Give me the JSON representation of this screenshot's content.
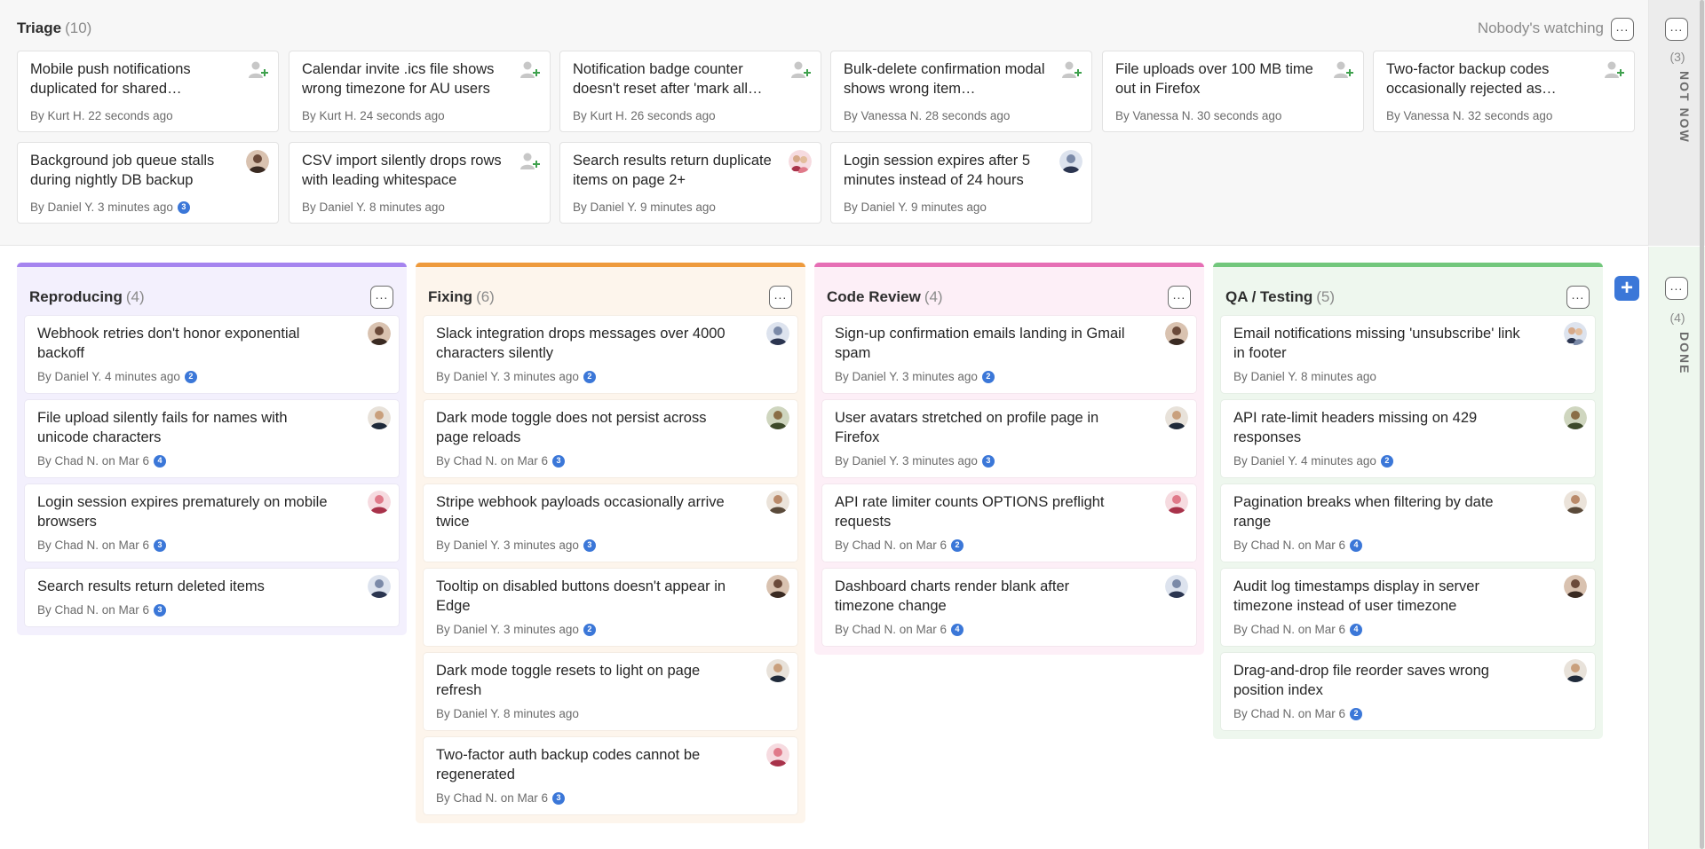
{
  "triage": {
    "title": "Triage",
    "count": "(10)",
    "watching": "Nobody's watching",
    "cards": [
      {
        "title": "Mobile push notifications duplicated for shared…",
        "meta": "By Kurt H. 22 seconds ago",
        "avatar": "add-assignee"
      },
      {
        "title": "Calendar invite .ics file shows wrong timezone for AU users",
        "meta": "By Kurt H. 24 seconds ago",
        "avatar": "add-assignee"
      },
      {
        "title": "Notification badge counter doesn't reset after 'mark all…",
        "meta": "By Kurt H. 26 seconds ago",
        "avatar": "add-assignee"
      },
      {
        "title": "Bulk-delete confirmation modal shows wrong item…",
        "meta": "By Vanessa N. 28 seconds ago",
        "avatar": "add-assignee"
      },
      {
        "title": "File uploads over 100 MB time out in Firefox",
        "meta": "By Vanessa N. 30 seconds ago",
        "avatar": "add-assignee"
      },
      {
        "title": "Two-factor backup codes occasionally rejected as…",
        "meta": "By Vanessa N. 32 seconds ago",
        "avatar": "add-assignee"
      },
      {
        "title": "Background job queue stalls during nightly DB backup",
        "meta": "By Daniel Y. 3 minutes ago",
        "badge": "3",
        "avatar": "person"
      },
      {
        "title": "CSV import silently drops rows with leading whitespace",
        "meta": "By Daniel Y. 8 minutes ago",
        "avatar": "add-assignee"
      },
      {
        "title": "Search results return duplicate items on page 2+",
        "meta": "By Daniel Y. 9 minutes ago",
        "avatar": "person-pair"
      },
      {
        "title": "Login session expires after 5 minutes instead of 24 hours",
        "meta": "By Daniel Y. 9 minutes ago",
        "avatar": "person"
      }
    ]
  },
  "columns": [
    {
      "title": "Reproducing",
      "count": "(4)",
      "cards": [
        {
          "title": "Webhook retries don't honor exponential backoff",
          "meta": "By Daniel Y. 4 minutes ago",
          "badge": "2"
        },
        {
          "title": "File upload silently fails for names with unicode characters",
          "meta": "By Chad N. on Mar 6",
          "badge": "4"
        },
        {
          "title": "Login session expires prematurely on mobile browsers",
          "meta": "By Chad N. on Mar 6",
          "badge": "3"
        },
        {
          "title": "Search results return deleted items",
          "meta": "By Chad N. on Mar 6",
          "badge": "3"
        }
      ]
    },
    {
      "title": "Fixing",
      "count": "(6)",
      "cards": [
        {
          "title": "Slack integration drops messages over 4000 characters silently",
          "meta": "By Daniel Y. 3 minutes ago",
          "badge": "2"
        },
        {
          "title": "Dark mode toggle does not persist across page reloads",
          "meta": "By Chad N. on Mar 6",
          "badge": "3"
        },
        {
          "title": "Stripe webhook payloads occasionally arrive twice",
          "meta": "By Daniel Y. 3 minutes ago",
          "badge": "3"
        },
        {
          "title": "Tooltip on disabled buttons doesn't appear in Edge",
          "meta": "By Daniel Y. 3 minutes ago",
          "badge": "2"
        },
        {
          "title": "Dark mode toggle resets to light on page refresh",
          "meta": "By Daniel Y. 8 minutes ago"
        },
        {
          "title": "Two-factor auth backup codes cannot be regenerated",
          "meta": "By Chad N. on Mar 6",
          "badge": "3"
        }
      ]
    },
    {
      "title": "Code Review",
      "count": "(4)",
      "cards": [
        {
          "title": "Sign-up confirmation emails landing in Gmail spam",
          "meta": "By Daniel Y. 3 minutes ago",
          "badge": "2"
        },
        {
          "title": "User avatars stretched on profile page in Firefox",
          "meta": "By Daniel Y. 3 minutes ago",
          "badge": "3"
        },
        {
          "title": "API rate limiter counts OPTIONS preflight requests",
          "meta": "By Chad N. on Mar 6",
          "badge": "2"
        },
        {
          "title": "Dashboard charts render blank after timezone change",
          "meta": "By Chad N. on Mar 6",
          "badge": "4"
        }
      ]
    },
    {
      "title": "QA / Testing",
      "count": "(5)",
      "cards": [
        {
          "title": "Email notifications missing 'unsubscribe' link in footer",
          "meta": "By Daniel Y. 8 minutes ago"
        },
        {
          "title": "API rate-limit headers missing on 429 responses",
          "meta": "By Daniel Y. 4 minutes ago",
          "badge": "2"
        },
        {
          "title": "Pagination breaks when filtering by date range",
          "meta": "By Chad N. on Mar 6",
          "badge": "4"
        },
        {
          "title": "Audit log timestamps display in server timezone instead of user timezone",
          "meta": "By Chad N. on Mar 6",
          "badge": "4"
        },
        {
          "title": "Drag-and-drop file reorder saves wrong position index",
          "meta": "By Chad N. on Mar 6",
          "badge": "2"
        }
      ]
    }
  ],
  "rails": {
    "not_now": {
      "count": "(3)",
      "label": "NOT NOW"
    },
    "done": {
      "count": "(4)",
      "label": "DONE"
    }
  },
  "menu_glyph": "...",
  "add_glyph": "+",
  "colors": {
    "accent": "#3b77d8",
    "reproducing": "#a584ef",
    "fixing": "#ee9a3d",
    "code_review": "#e66fb5",
    "qa_testing": "#72c77c"
  }
}
